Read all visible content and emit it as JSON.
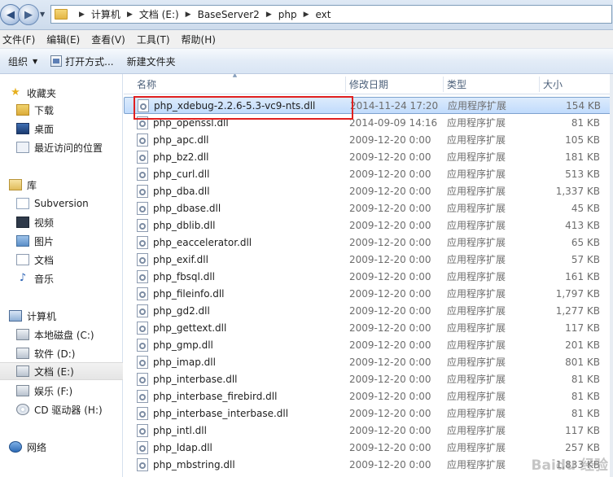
{
  "address_bar": {
    "breadcrumbs": [
      "计算机",
      "文档 (E:)",
      "BaseServer2",
      "php",
      "ext"
    ]
  },
  "menu": [
    "文件(F)",
    "编辑(E)",
    "查看(V)",
    "工具(T)",
    "帮助(H)"
  ],
  "toolbar": {
    "organize_label": "组织",
    "open_label": "打开方式...",
    "new_folder_label": "新建文件夹"
  },
  "nav": {
    "favorites": "收藏夹",
    "downloads": "下载",
    "desktop": "桌面",
    "recent": "最近访问的位置",
    "libraries": "库",
    "subversion": "Subversion",
    "videos": "视频",
    "pictures": "图片",
    "documents": "文档",
    "music": "音乐",
    "computer": "计算机",
    "drive_c": "本地磁盘 (C:)",
    "drive_d": "软件 (D:)",
    "drive_e": "文档 (E:)",
    "drive_f": "娱乐 (F:)",
    "drive_h": "CD 驱动器 (H:)",
    "network": "网络"
  },
  "columns": {
    "name": "名称",
    "date": "修改日期",
    "type": "类型",
    "size": "大小"
  },
  "files": [
    {
      "name": "php_xdebug-2.2.6-5.3-vc9-nts.dll",
      "date": "2014-11-24 17:20",
      "type": "应用程序扩展",
      "size": "154 KB"
    },
    {
      "name": "php_openssl.dll",
      "date": "2014-09-09 14:16",
      "type": "应用程序扩展",
      "size": "81 KB"
    },
    {
      "name": "php_apc.dll",
      "date": "2009-12-20 0:00",
      "type": "应用程序扩展",
      "size": "105 KB"
    },
    {
      "name": "php_bz2.dll",
      "date": "2009-12-20 0:00",
      "type": "应用程序扩展",
      "size": "181 KB"
    },
    {
      "name": "php_curl.dll",
      "date": "2009-12-20 0:00",
      "type": "应用程序扩展",
      "size": "513 KB"
    },
    {
      "name": "php_dba.dll",
      "date": "2009-12-20 0:00",
      "type": "应用程序扩展",
      "size": "1,337 KB"
    },
    {
      "name": "php_dbase.dll",
      "date": "2009-12-20 0:00",
      "type": "应用程序扩展",
      "size": "45 KB"
    },
    {
      "name": "php_dblib.dll",
      "date": "2009-12-20 0:00",
      "type": "应用程序扩展",
      "size": "413 KB"
    },
    {
      "name": "php_eaccelerator.dll",
      "date": "2009-12-20 0:00",
      "type": "应用程序扩展",
      "size": "65 KB"
    },
    {
      "name": "php_exif.dll",
      "date": "2009-12-20 0:00",
      "type": "应用程序扩展",
      "size": "57 KB"
    },
    {
      "name": "php_fbsql.dll",
      "date": "2009-12-20 0:00",
      "type": "应用程序扩展",
      "size": "161 KB"
    },
    {
      "name": "php_fileinfo.dll",
      "date": "2009-12-20 0:00",
      "type": "应用程序扩展",
      "size": "1,797 KB"
    },
    {
      "name": "php_gd2.dll",
      "date": "2009-12-20 0:00",
      "type": "应用程序扩展",
      "size": "1,277 KB"
    },
    {
      "name": "php_gettext.dll",
      "date": "2009-12-20 0:00",
      "type": "应用程序扩展",
      "size": "117 KB"
    },
    {
      "name": "php_gmp.dll",
      "date": "2009-12-20 0:00",
      "type": "应用程序扩展",
      "size": "201 KB"
    },
    {
      "name": "php_imap.dll",
      "date": "2009-12-20 0:00",
      "type": "应用程序扩展",
      "size": "801 KB"
    },
    {
      "name": "php_interbase.dll",
      "date": "2009-12-20 0:00",
      "type": "应用程序扩展",
      "size": "81 KB"
    },
    {
      "name": "php_interbase_firebird.dll",
      "date": "2009-12-20 0:00",
      "type": "应用程序扩展",
      "size": "81 KB"
    },
    {
      "name": "php_interbase_interbase.dll",
      "date": "2009-12-20 0:00",
      "type": "应用程序扩展",
      "size": "81 KB"
    },
    {
      "name": "php_intl.dll",
      "date": "2009-12-20 0:00",
      "type": "应用程序扩展",
      "size": "117 KB"
    },
    {
      "name": "php_ldap.dll",
      "date": "2009-12-20 0:00",
      "type": "应用程序扩展",
      "size": "257 KB"
    },
    {
      "name": "php_mbstring.dll",
      "date": "2009-12-20 0:00",
      "type": "应用程序扩展",
      "size": "1,833 KB"
    }
  ],
  "watermark": "Baidu 经验",
  "watermark_sub": "jingyan.baidu.com"
}
